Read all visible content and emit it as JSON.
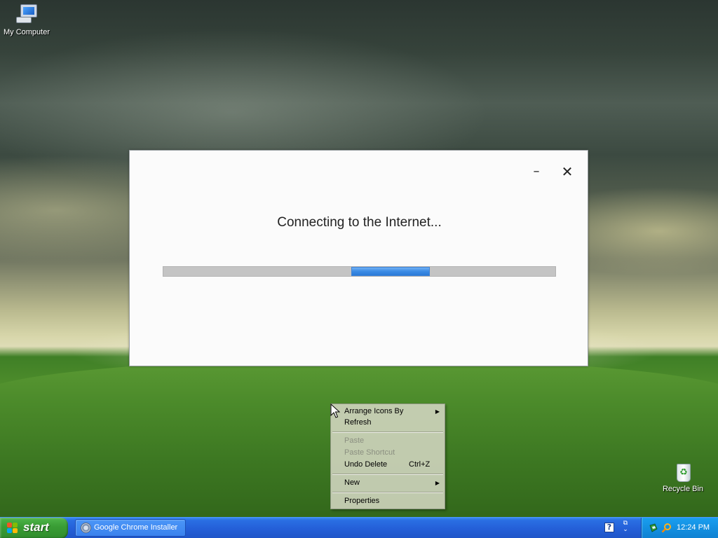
{
  "desktop": {
    "icons": [
      {
        "label": "My Computer",
        "icon": "my-computer-icon"
      },
      {
        "label": "Recycle Bin",
        "icon": "recycle-bin-icon"
      }
    ]
  },
  "installer": {
    "status_text": "Connecting to the Internet...",
    "minimize_glyph": "–",
    "close_glyph": "✕",
    "progress": {
      "mode": "indeterminate",
      "segment_start_fraction": 0.48,
      "segment_width_fraction": 0.2
    },
    "accent_color": "#3d8de5"
  },
  "context_menu": {
    "items": [
      {
        "label": "Arrange Icons By",
        "submenu": true,
        "disabled": false
      },
      {
        "label": "Refresh",
        "disabled": false
      },
      {
        "label": "Paste",
        "disabled": true
      },
      {
        "label": "Paste Shortcut",
        "disabled": true
      },
      {
        "label": "Undo Delete",
        "shortcut": "Ctrl+Z",
        "disabled": false
      },
      {
        "label": "New",
        "submenu": true,
        "disabled": false
      },
      {
        "label": "Properties",
        "disabled": false
      }
    ],
    "submenu_glyph": "▶"
  },
  "taskbar": {
    "start_label": "start",
    "tasks": [
      {
        "label": "Google Chrome Installer",
        "icon": "installer-icon"
      }
    ],
    "help_glyph": "?",
    "clock": "12:24 PM",
    "colors": {
      "taskbar": "#245fd8",
      "start": "#3a9e35",
      "tray": "#138fe0"
    }
  }
}
